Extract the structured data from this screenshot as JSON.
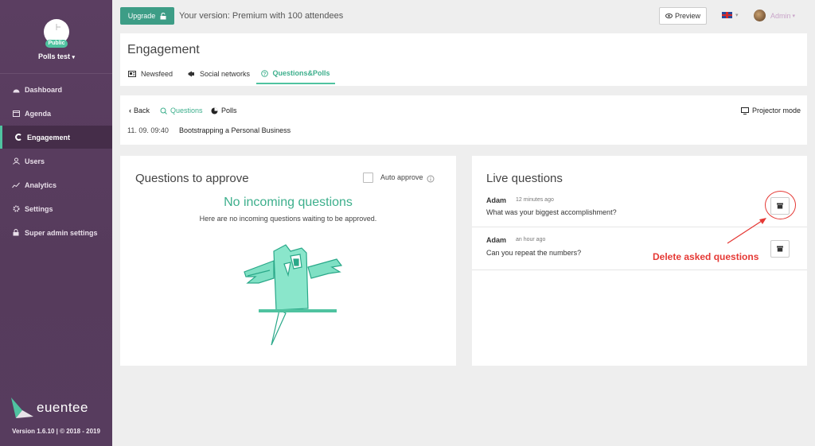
{
  "sidebar": {
    "badge": "Public",
    "event_name": "Polls test",
    "items": [
      {
        "label": "Dashboard",
        "icon": "dashboard-icon"
      },
      {
        "label": "Agenda",
        "icon": "calendar-icon"
      },
      {
        "label": "Engagement",
        "icon": "engagement-icon"
      },
      {
        "label": "Users",
        "icon": "users-icon"
      },
      {
        "label": "Analytics",
        "icon": "chart-icon"
      },
      {
        "label": "Settings",
        "icon": "gear-icon"
      },
      {
        "label": "Super admin settings",
        "icon": "lock-icon"
      }
    ],
    "logo_text": "euentee",
    "version": "Version 1.6.10 | © 2018 - 2019"
  },
  "topbar": {
    "upgrade_label": "Upgrade",
    "version_text": "Your version: Premium with 100 attendees",
    "preview_label": "Preview",
    "admin_label": "Admin"
  },
  "engagement": {
    "title": "Engagement",
    "tabs": [
      {
        "label": "Newsfeed"
      },
      {
        "label": "Social networks"
      },
      {
        "label": "Questions&Polls"
      }
    ]
  },
  "session": {
    "back_label": "Back",
    "questions_label": "Questions",
    "polls_label": "Polls",
    "projector_label": "Projector mode",
    "time": "11. 09. 09:40",
    "title": "Bootstrapping a Personal Business"
  },
  "approve": {
    "title": "Questions to approve",
    "auto_label": "Auto approve",
    "empty_title": "No incoming questions",
    "empty_text": "Here are no incoming questions waiting to be approved."
  },
  "live": {
    "title": "Live questions",
    "questions": [
      {
        "author": "Adam",
        "time": "12 minutes ago",
        "text": "What was your biggest accomplishment?"
      },
      {
        "author": "Adam",
        "time": "an hour ago",
        "text": "Can you repeat the numbers?"
      }
    ]
  },
  "annotation": {
    "text": "Delete asked questions",
    "color": "#e53935"
  },
  "colors": {
    "accent": "#4fc3a0",
    "sidebar": "#5a3d5f",
    "upgrade": "#3d9d86"
  }
}
